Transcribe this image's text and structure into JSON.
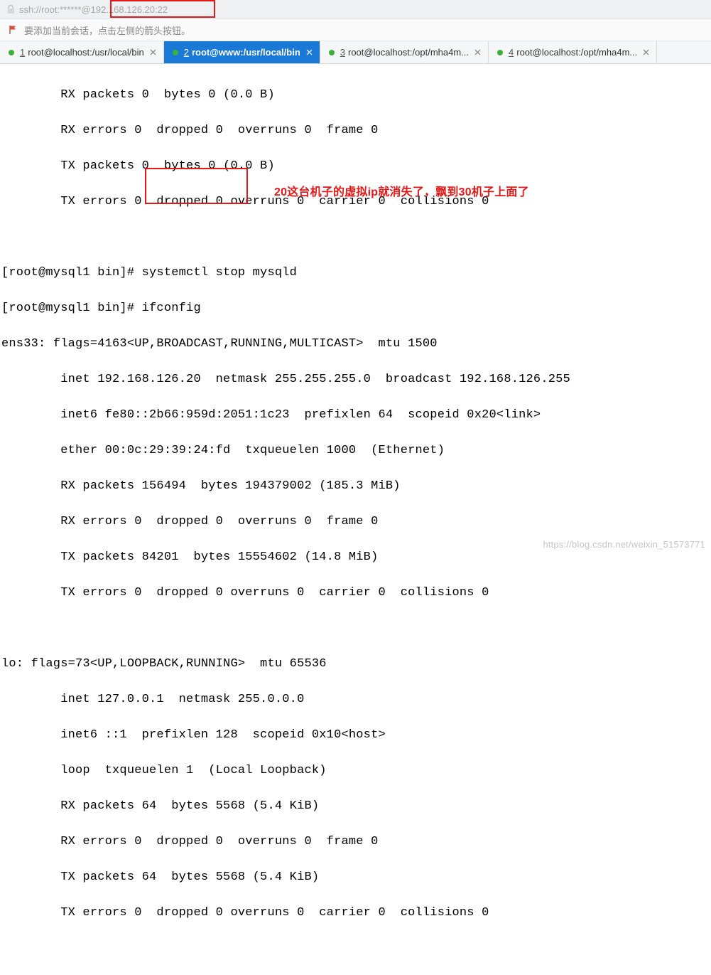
{
  "address_bar": {
    "url_text": "ssh://root:******@192.168.126.20:22"
  },
  "info_bar": {
    "hint": "要添加当前会话，点击左侧的箭头按钮。"
  },
  "tabs": [
    {
      "num": "1",
      "label": "root@localhost:/usr/local/bin",
      "active": false
    },
    {
      "num": "2",
      "label": "root@www:/usr/local/bin",
      "active": true
    },
    {
      "num": "3",
      "label": "root@localhost:/opt/mha4m...",
      "active": false
    },
    {
      "num": "4",
      "label": "root@localhost:/opt/mha4m...",
      "active": false
    }
  ],
  "annotation": {
    "text": "20这台机子的虚拟ip就消失了，飘到30机子上面了"
  },
  "terminal_lines": {
    "l01": "        RX packets 0  bytes 0 (0.0 B)",
    "l02": "        RX errors 0  dropped 0  overruns 0  frame 0",
    "l03": "        TX packets 0  bytes 0 (0.0 B)",
    "l04": "        TX errors 0  dropped 0 overruns 0  carrier 0  collisions 0",
    "l05": "",
    "l06": "[root@mysql1 bin]# systemctl stop mysqld",
    "l07": "[root@mysql1 bin]# ifconfig",
    "l08": "ens33: flags=4163<UP,BROADCAST,RUNNING,MULTICAST>  mtu 1500",
    "l09": "        inet 192.168.126.20  netmask 255.255.255.0  broadcast 192.168.126.255",
    "l10": "        inet6 fe80::2b66:959d:2051:1c23  prefixlen 64  scopeid 0x20<link>",
    "l11": "        ether 00:0c:29:39:24:fd  txqueuelen 1000  (Ethernet)",
    "l12": "        RX packets 156494  bytes 194379002 (185.3 MiB)",
    "l13": "        RX errors 0  dropped 0  overruns 0  frame 0",
    "l14": "        TX packets 84201  bytes 15554602 (14.8 MiB)",
    "l15": "        TX errors 0  dropped 0 overruns 0  carrier 0  collisions 0",
    "l16": "",
    "l17": "lo: flags=73<UP,LOOPBACK,RUNNING>  mtu 65536",
    "l18": "        inet 127.0.0.1  netmask 255.0.0.0",
    "l19": "        inet6 ::1  prefixlen 128  scopeid 0x10<host>",
    "l20": "        loop  txqueuelen 1  (Local Loopback)",
    "l21": "        RX packets 64  bytes 5568 (5.4 KiB)",
    "l22": "        RX errors 0  dropped 0  overruns 0  frame 0",
    "l23": "        TX packets 64  bytes 5568 (5.4 KiB)",
    "l24": "        TX errors 0  dropped 0 overruns 0  carrier 0  collisions 0"
  },
  "watermark": {
    "text": "https://blog.csdn.net/weixin_51573771"
  }
}
